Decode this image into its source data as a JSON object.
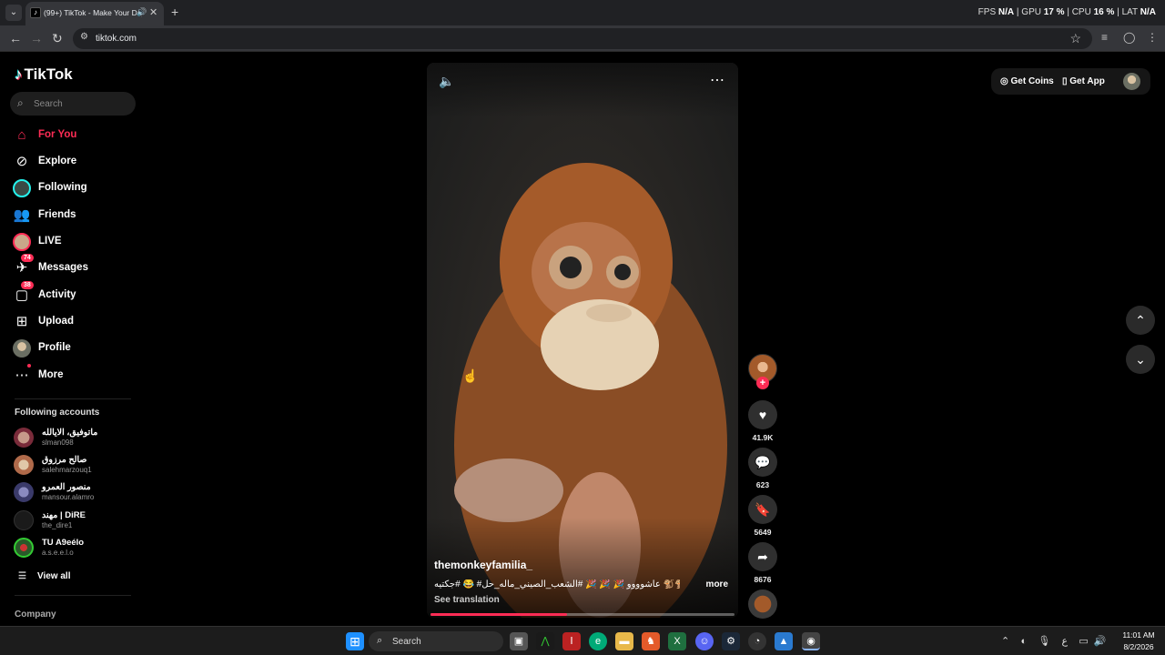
{
  "browser": {
    "tab_title": "(99+) TikTok - Make Your Day",
    "url": "tiktok.com",
    "perf": {
      "fps_label": "FPS",
      "fps": "N/A",
      "gpu_label": "GPU",
      "gpu": "17 %",
      "cpu_label": "CPU",
      "cpu": "16 %",
      "lat_label": "LAT",
      "lat": "N/A"
    }
  },
  "sidebar": {
    "logo": "TikTok",
    "search_placeholder": "Search",
    "nav": [
      {
        "label": "For You",
        "icon": "home-icon"
      },
      {
        "label": "Explore",
        "icon": "compass-icon"
      },
      {
        "label": "Following",
        "icon": "following-avatar-icon"
      },
      {
        "label": "Friends",
        "icon": "friends-icon"
      },
      {
        "label": "LIVE",
        "icon": "live-avatar-icon"
      },
      {
        "label": "Messages",
        "icon": "messages-icon",
        "badge": "74"
      },
      {
        "label": "Activity",
        "icon": "activity-icon",
        "badge": "38"
      },
      {
        "label": "Upload",
        "icon": "upload-icon"
      },
      {
        "label": "Profile",
        "icon": "profile-avatar-icon"
      },
      {
        "label": "More",
        "icon": "more-dots-icon"
      }
    ],
    "following_heading": "Following accounts",
    "accounts": [
      {
        "name": "ماتوفيق، الايالله",
        "handle": "slman098"
      },
      {
        "name": "صالح مرزوق",
        "handle": "salehmarzouq1"
      },
      {
        "name": "منصور العمرو",
        "handle": "mansour.alamro"
      },
      {
        "name": "مهند | DiRE",
        "handle": "the_dire1"
      },
      {
        "name": "TU A9eélo",
        "handle": "a.s.e.e.l.o"
      }
    ],
    "view_all": "View all",
    "company": "Company"
  },
  "video": {
    "creator": "themonkeyfamilia_",
    "caption": "عاشوووو 🎉 🎉 🎉 #الشعب_الصيني_ماله_حل# 😂 #جكتيه 🐒🐒 ✂️",
    "more": "more",
    "see_translation": "See translation",
    "progress": 0.45
  },
  "actions": {
    "likes": "41.9K",
    "comments": "623",
    "saves": "5649",
    "shares": "8676"
  },
  "top_right": {
    "get_coins": "Get Coins",
    "get_app": "Get App"
  },
  "taskbar": {
    "search_placeholder": "Search",
    "time": "11:01 AM",
    "date": "8/2/2026",
    "lang": "ع"
  },
  "colors": {
    "accent": "#fe2c55",
    "cyan": "#25f4ee"
  }
}
